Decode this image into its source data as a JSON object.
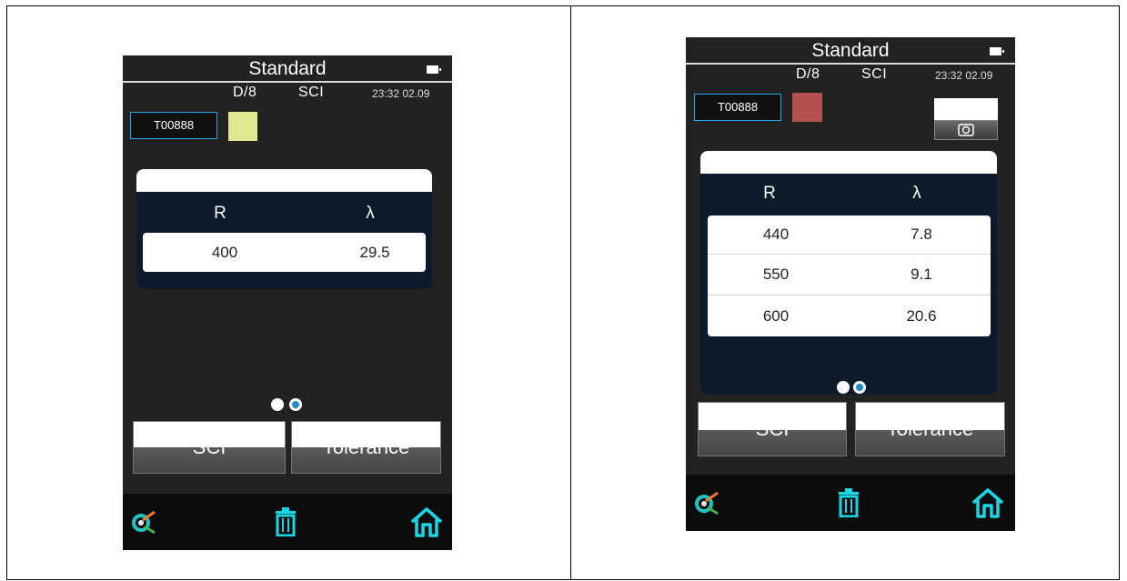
{
  "left": {
    "title": "Standard",
    "mode": "D/8",
    "mode_sub": "SCI",
    "clock": "23:32 02.09",
    "standard_id": "T00888",
    "swatch_color": "#e0e98f",
    "table": {
      "headers": [
        "R",
        "λ"
      ],
      "rows": [
        {
          "r": "400",
          "lambda": "29.5"
        }
      ]
    },
    "page_dots": {
      "current": 1,
      "total": 2
    },
    "buttons": {
      "sci": "SCI",
      "tolerance": "Tolerance"
    }
  },
  "right": {
    "title": "Standard",
    "mode": "D/8",
    "mode_sub": "SCI",
    "clock": "23:32 02.09",
    "standard_id": "T00888",
    "swatch_color": "#b35050",
    "table": {
      "headers": [
        "R",
        "λ"
      ],
      "rows": [
        {
          "r": "440",
          "lambda": "7.8"
        },
        {
          "r": "550",
          "lambda": "9.1"
        },
        {
          "r": "600",
          "lambda": "20.6"
        }
      ]
    },
    "page_dots": {
      "current": 1,
      "total": 2
    },
    "buttons": {
      "sci": "SCI",
      "tolerance": "Tolerance"
    }
  },
  "icons": {
    "measure": "target-measure-icon",
    "delete": "trash-icon",
    "home": "home-icon"
  },
  "colors": {
    "accent": "#2aa7e0",
    "icon_cyan": "#18d7e6",
    "card_bg": "#0b1b2c"
  }
}
